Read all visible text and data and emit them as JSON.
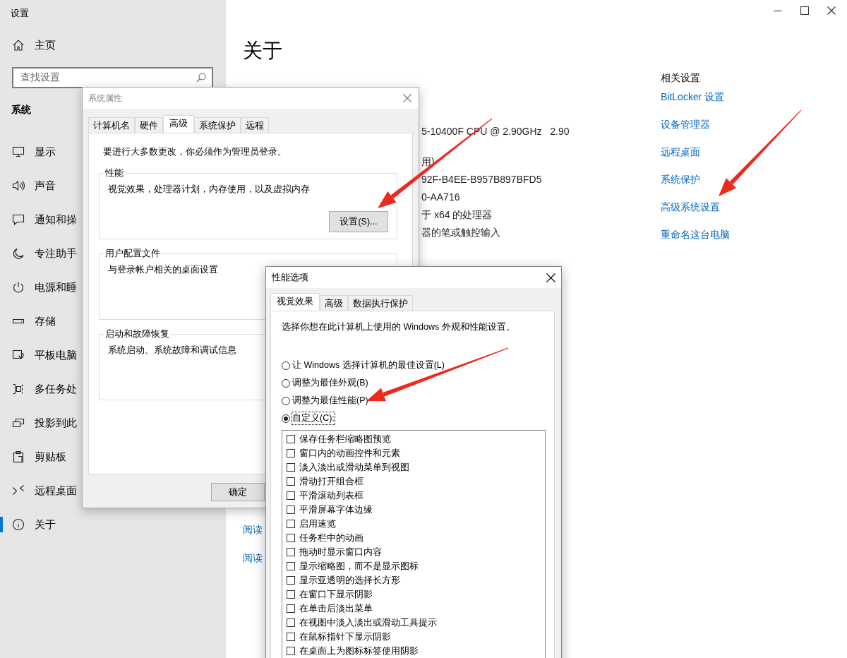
{
  "window": {
    "title": "设置"
  },
  "sidebar": {
    "home": "主页",
    "search": {
      "placeholder": "查找设置"
    },
    "section": "系统",
    "items": [
      {
        "label": "显示",
        "selected": false
      },
      {
        "label": "声音",
        "selected": false
      },
      {
        "label": "通知和操",
        "selected": false
      },
      {
        "label": "专注助手",
        "selected": false
      },
      {
        "label": "电源和睡",
        "selected": false
      },
      {
        "label": "存储",
        "selected": false
      },
      {
        "label": "平板电脑",
        "selected": false
      },
      {
        "label": "多任务处",
        "selected": false
      },
      {
        "label": "投影到此",
        "selected": false
      },
      {
        "label": "剪贴板",
        "selected": false
      },
      {
        "label": "远程桌面",
        "selected": false
      },
      {
        "label": "关于",
        "selected": true
      }
    ]
  },
  "main": {
    "title": "关于",
    "spec_fragments": [
      "5-10400F CPU @ 2.90GHz   2.90",
      "用)",
      "92F-B4EE-B957B897BFD5",
      "0-AA716",
      "于 x64 的处理器",
      "器的笔或触控输入"
    ],
    "links": [
      "阅读",
      "阅读"
    ]
  },
  "related_settings": {
    "title": "相关设置",
    "links": [
      "BitLocker 设置",
      "设备管理器",
      "远程桌面",
      "系统保护",
      "高级系统设置",
      "重命名这台电脑"
    ]
  },
  "system_properties": {
    "title": "系统属性",
    "tabs": [
      {
        "label": "计算机名",
        "selected": false
      },
      {
        "label": "硬件",
        "selected": false
      },
      {
        "label": "高级",
        "selected": true
      },
      {
        "label": "系统保护",
        "selected": false
      },
      {
        "label": "远程",
        "selected": false
      }
    ],
    "notice": "要进行大多数更改，你必须作为管理员登录。",
    "groups": [
      {
        "title": "性能",
        "text": "视觉效果，处理器计划，内存使用，以及虚拟内存",
        "button": "设置(S)..."
      },
      {
        "title": "用户配置文件",
        "text": "与登录帐户相关的桌面设置"
      },
      {
        "title": "启动和故障恢复",
        "text": "系统启动、系统故障和调试信息"
      }
    ],
    "buttons": [
      "确定"
    ]
  },
  "performance_options": {
    "title": "性能选项",
    "tabs": [
      {
        "label": "视觉效果",
        "selected": true
      },
      {
        "label": "高级",
        "selected": false
      },
      {
        "label": "数据执行保护",
        "selected": false
      }
    ],
    "description": "选择你想在此计算机上使用的 Windows 外观和性能设置。",
    "options": [
      {
        "label": "让 Windows 选择计算机的最佳设置(L)",
        "selected": false
      },
      {
        "label": "调整为最佳外观(B)",
        "selected": false
      },
      {
        "label": "调整为最佳性能(P)",
        "selected": false
      },
      {
        "label": "自定义(C):",
        "selected": true
      }
    ],
    "effects": [
      {
        "label": "保存任务栏缩略图预览",
        "checked": false
      },
      {
        "label": "窗口内的动画控件和元素",
        "checked": false
      },
      {
        "label": "淡入淡出或滑动菜单到视图",
        "checked": false
      },
      {
        "label": "滑动打开组合框",
        "checked": false
      },
      {
        "label": "平滑滚动列表框",
        "checked": false
      },
      {
        "label": "平滑屏幕字体边缘",
        "checked": false
      },
      {
        "label": "启用速览",
        "checked": false
      },
      {
        "label": "任务栏中的动画",
        "checked": false
      },
      {
        "label": "拖动时显示窗口内容",
        "checked": false
      },
      {
        "label": "显示缩略图，而不是显示图标",
        "checked": false
      },
      {
        "label": "显示亚透明的选择长方形",
        "checked": false
      },
      {
        "label": "在窗口下显示阴影",
        "checked": false
      },
      {
        "label": "在单击后淡出菜单",
        "checked": false
      },
      {
        "label": "在视图中淡入淡出或滑动工具提示",
        "checked": false
      },
      {
        "label": "在鼠标指针下显示阴影",
        "checked": false
      },
      {
        "label": "在桌面上为图标标签使用阴影",
        "checked": false
      }
    ]
  }
}
